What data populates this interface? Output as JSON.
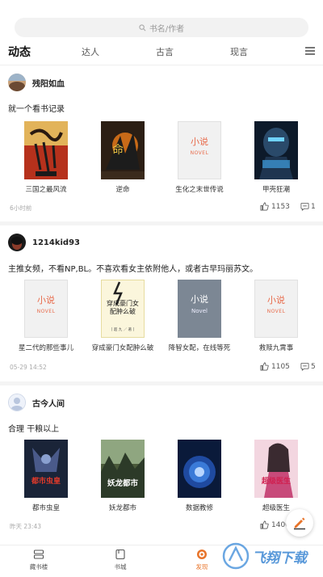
{
  "search": {
    "placeholder": "书名/作者"
  },
  "tabs": [
    "动态",
    "达人",
    "古言",
    "现言"
  ],
  "posts": [
    {
      "username": "残阳如血",
      "text": "就一个看书记录",
      "time": "6小时前",
      "likes": "1153",
      "comments": "1",
      "books": [
        {
          "title": "三国之最风流"
        },
        {
          "title": "逆命"
        },
        {
          "title": "生化之末世传说",
          "placeholder": true
        },
        {
          "title": "甲壳狂潮"
        }
      ]
    },
    {
      "username": "1214kid93",
      "text": "主推女频，不看NP,BL。不喜欢看女主依附他人，或者古早玛丽苏文。",
      "time": "05-29 14:52",
      "likes": "1105",
      "comments": "5",
      "books": [
        {
          "title": "星二代的那些事儿",
          "placeholder": true
        },
        {
          "title": "穿成豪门女配肿么破"
        },
        {
          "title": "降智女配，在线等死",
          "placeholder": true
        },
        {
          "title": "救赎九霄事",
          "placeholder": true
        }
      ]
    },
    {
      "username": "古今人间",
      "text": "合理 干粮以上",
      "time": "昨天 23:43",
      "likes": "1400",
      "comments": "",
      "books": [
        {
          "title": "都市虫皇"
        },
        {
          "title": "妖龙都市"
        },
        {
          "title": "数据教修"
        },
        {
          "title": "超级医生"
        }
      ]
    }
  ],
  "placeholder_cover": {
    "main": "小说",
    "sub": "NOVEL",
    "grey_sub": "Novel"
  },
  "cover_text": {
    "book2_1": "穿成豪门女配肿么破",
    "book2_1_sub": "[ 超 九 ／ 著 ]",
    "book3_0": "都市虫皇",
    "book3_1": "妖龙都市",
    "book3_3": "超级医生"
  },
  "bottom_nav": [
    {
      "label": "藏书楼",
      "icon": "bookshelf-icon"
    },
    {
      "label": "书城",
      "icon": "store-icon"
    },
    {
      "label": "发现",
      "icon": "discover-icon",
      "active": true
    }
  ],
  "watermark": "飞翔下载",
  "colors": {
    "accent": "#e8742a",
    "placeholder_text": "#e86a4a"
  }
}
